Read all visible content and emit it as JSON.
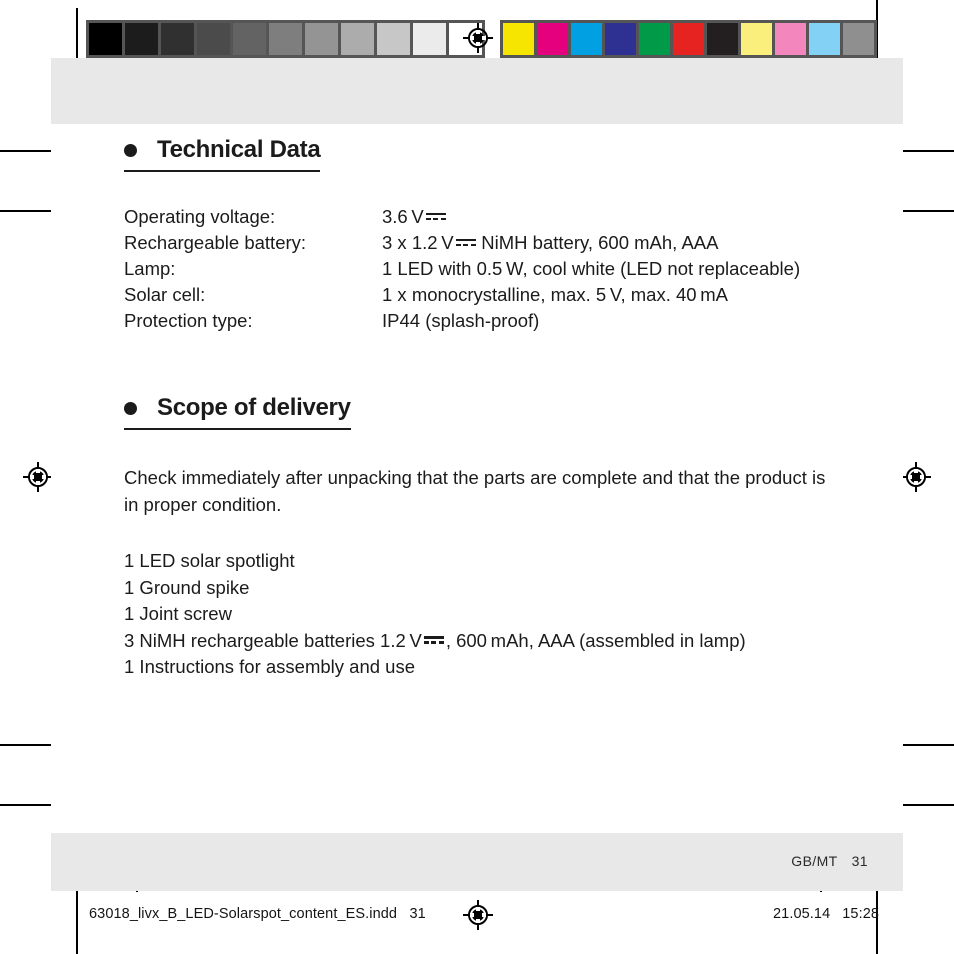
{
  "prepress": {
    "gray_wedge": {
      "name": "grayscale-step-wedge",
      "patches": [
        "#000000",
        "#1c1c1c",
        "#303030",
        "#4b4b4b",
        "#636363",
        "#7e7e7e",
        "#949494",
        "#acacac",
        "#c7c7c7",
        "#ebebeb",
        "#ffffff"
      ]
    },
    "ink_patches": {
      "name": "process-color-control-bar",
      "patches": [
        "#f6e500",
        "#e5007d",
        "#00a0e3",
        "#2e3192",
        "#009a49",
        "#e62320",
        "#231f20",
        "#faee7d",
        "#f486be",
        "#83d2f5",
        "#8f8f8f"
      ]
    },
    "registration_marks": [
      "top",
      "bottom",
      "left",
      "right"
    ]
  },
  "document": {
    "sections": [
      {
        "id": "technical-data",
        "heading": "Technical Data",
        "bullet": "filled-circle-bullet",
        "specs": [
          {
            "label": "Operating voltage:",
            "value_pre": "3.6 V",
            "dc_symbol": true,
            "value_post": ""
          },
          {
            "label": "Rechargeable battery:",
            "value_pre": "3 x 1.2 V",
            "dc_symbol": true,
            "value_post": " NiMH battery, 600 mAh, AAA"
          },
          {
            "label": "Lamp:",
            "value_pre": "1 LED with 0.5 W, cool white (LED not replaceable)",
            "dc_symbol": false,
            "value_post": ""
          },
          {
            "label": "Solar cell:",
            "value_pre": "1 x monocrystalline, max. 5 V, max. 40 mA",
            "dc_symbol": false,
            "value_post": ""
          },
          {
            "label": "Protection type:",
            "value_pre": "IP44 (splash-proof)",
            "dc_symbol": false,
            "value_post": ""
          }
        ]
      },
      {
        "id": "scope-of-delivery",
        "heading": "Scope of delivery",
        "bullet": "filled-circle-bullet",
        "paragraph": "Check immediately after unpacking that the parts are complete and that the product is in proper condition.",
        "items": [
          {
            "text_pre": "1 LED solar spotlight",
            "dc_symbol": false,
            "text_post": ""
          },
          {
            "text_pre": "1 Ground spike",
            "dc_symbol": false,
            "text_post": ""
          },
          {
            "text_pre": "1 Joint screw",
            "dc_symbol": false,
            "text_post": ""
          },
          {
            "text_pre": "3 NiMH rechargeable batteries 1.2 V",
            "dc_symbol": true,
            "text_post": ", 600 mAh, AAA (assembled in lamp)"
          },
          {
            "text_pre": "1 Instructions for assembly and use",
            "dc_symbol": false,
            "text_post": ""
          }
        ]
      }
    ],
    "footer": {
      "locale": "GB/MT",
      "page_number": "31"
    }
  },
  "slug": {
    "filename": "63018_livx_B_LED-Solarspot_content_ES.indd",
    "page": "31",
    "date": "21.05.14",
    "time": "15:28"
  }
}
